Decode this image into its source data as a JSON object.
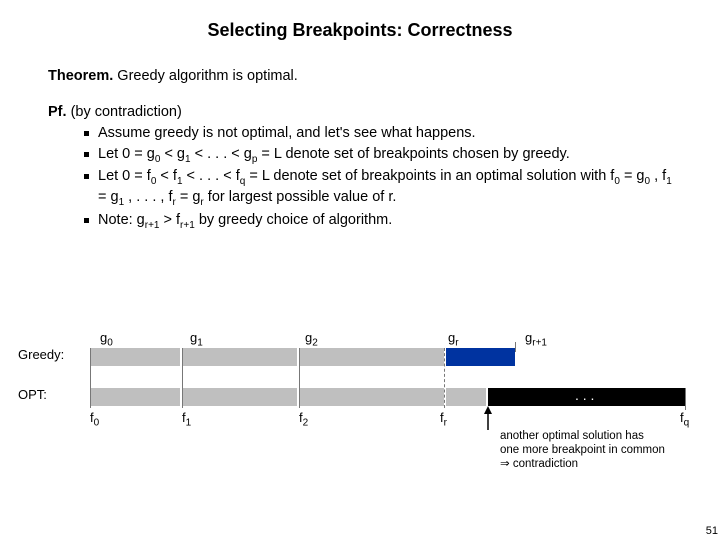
{
  "title": "Selecting Breakpoints:  Correctness",
  "theorem": {
    "label": "Theorem.",
    "text": "Greedy algorithm is optimal."
  },
  "proof": {
    "label": "Pf.",
    "intro": "(by contradiction)",
    "bullets": {
      "b1": "Assume greedy is not optimal, and let's see what happens.",
      "b2a": "Let 0 = g",
      "b2b": " < g",
      "b2c": " < . . . < g",
      "b2d": " = L denote set of breakpoints chosen by greedy.",
      "b3a": "Let 0 = f",
      "b3b": " < f",
      "b3c": " < . . . < f",
      "b3d": " = L denote set of breakpoints in an optimal solution with f",
      "b3e": " = g",
      "b3f": ", f",
      "b3g": "= g",
      "b3h": " , . . . , f",
      "b3i": " = g",
      "b3j": " for largest possible value of r.",
      "b4a": "Note: g",
      "b4b": " > f",
      "b4c": "  by greedy choice of algorithm."
    }
  },
  "labels": {
    "greedy": "Greedy:",
    "opt": "OPT:",
    "g0": "g",
    "g1": "g",
    "g2": "g",
    "gr": "g",
    "gr1": "g",
    "f0": "f",
    "f1": "f",
    "f2": "f",
    "fr": "f",
    "fq": "f",
    "sub0": "0",
    "sub1": "1",
    "sub2": "2",
    "subr": "r",
    "subr1": "r+1",
    "subp": "p",
    "subq": "q"
  },
  "note": {
    "l1": "another optimal solution has",
    "l2": "one more breakpoint in common",
    "l3": "⇒ contradiction"
  },
  "dots": ". . .",
  "page": "51"
}
